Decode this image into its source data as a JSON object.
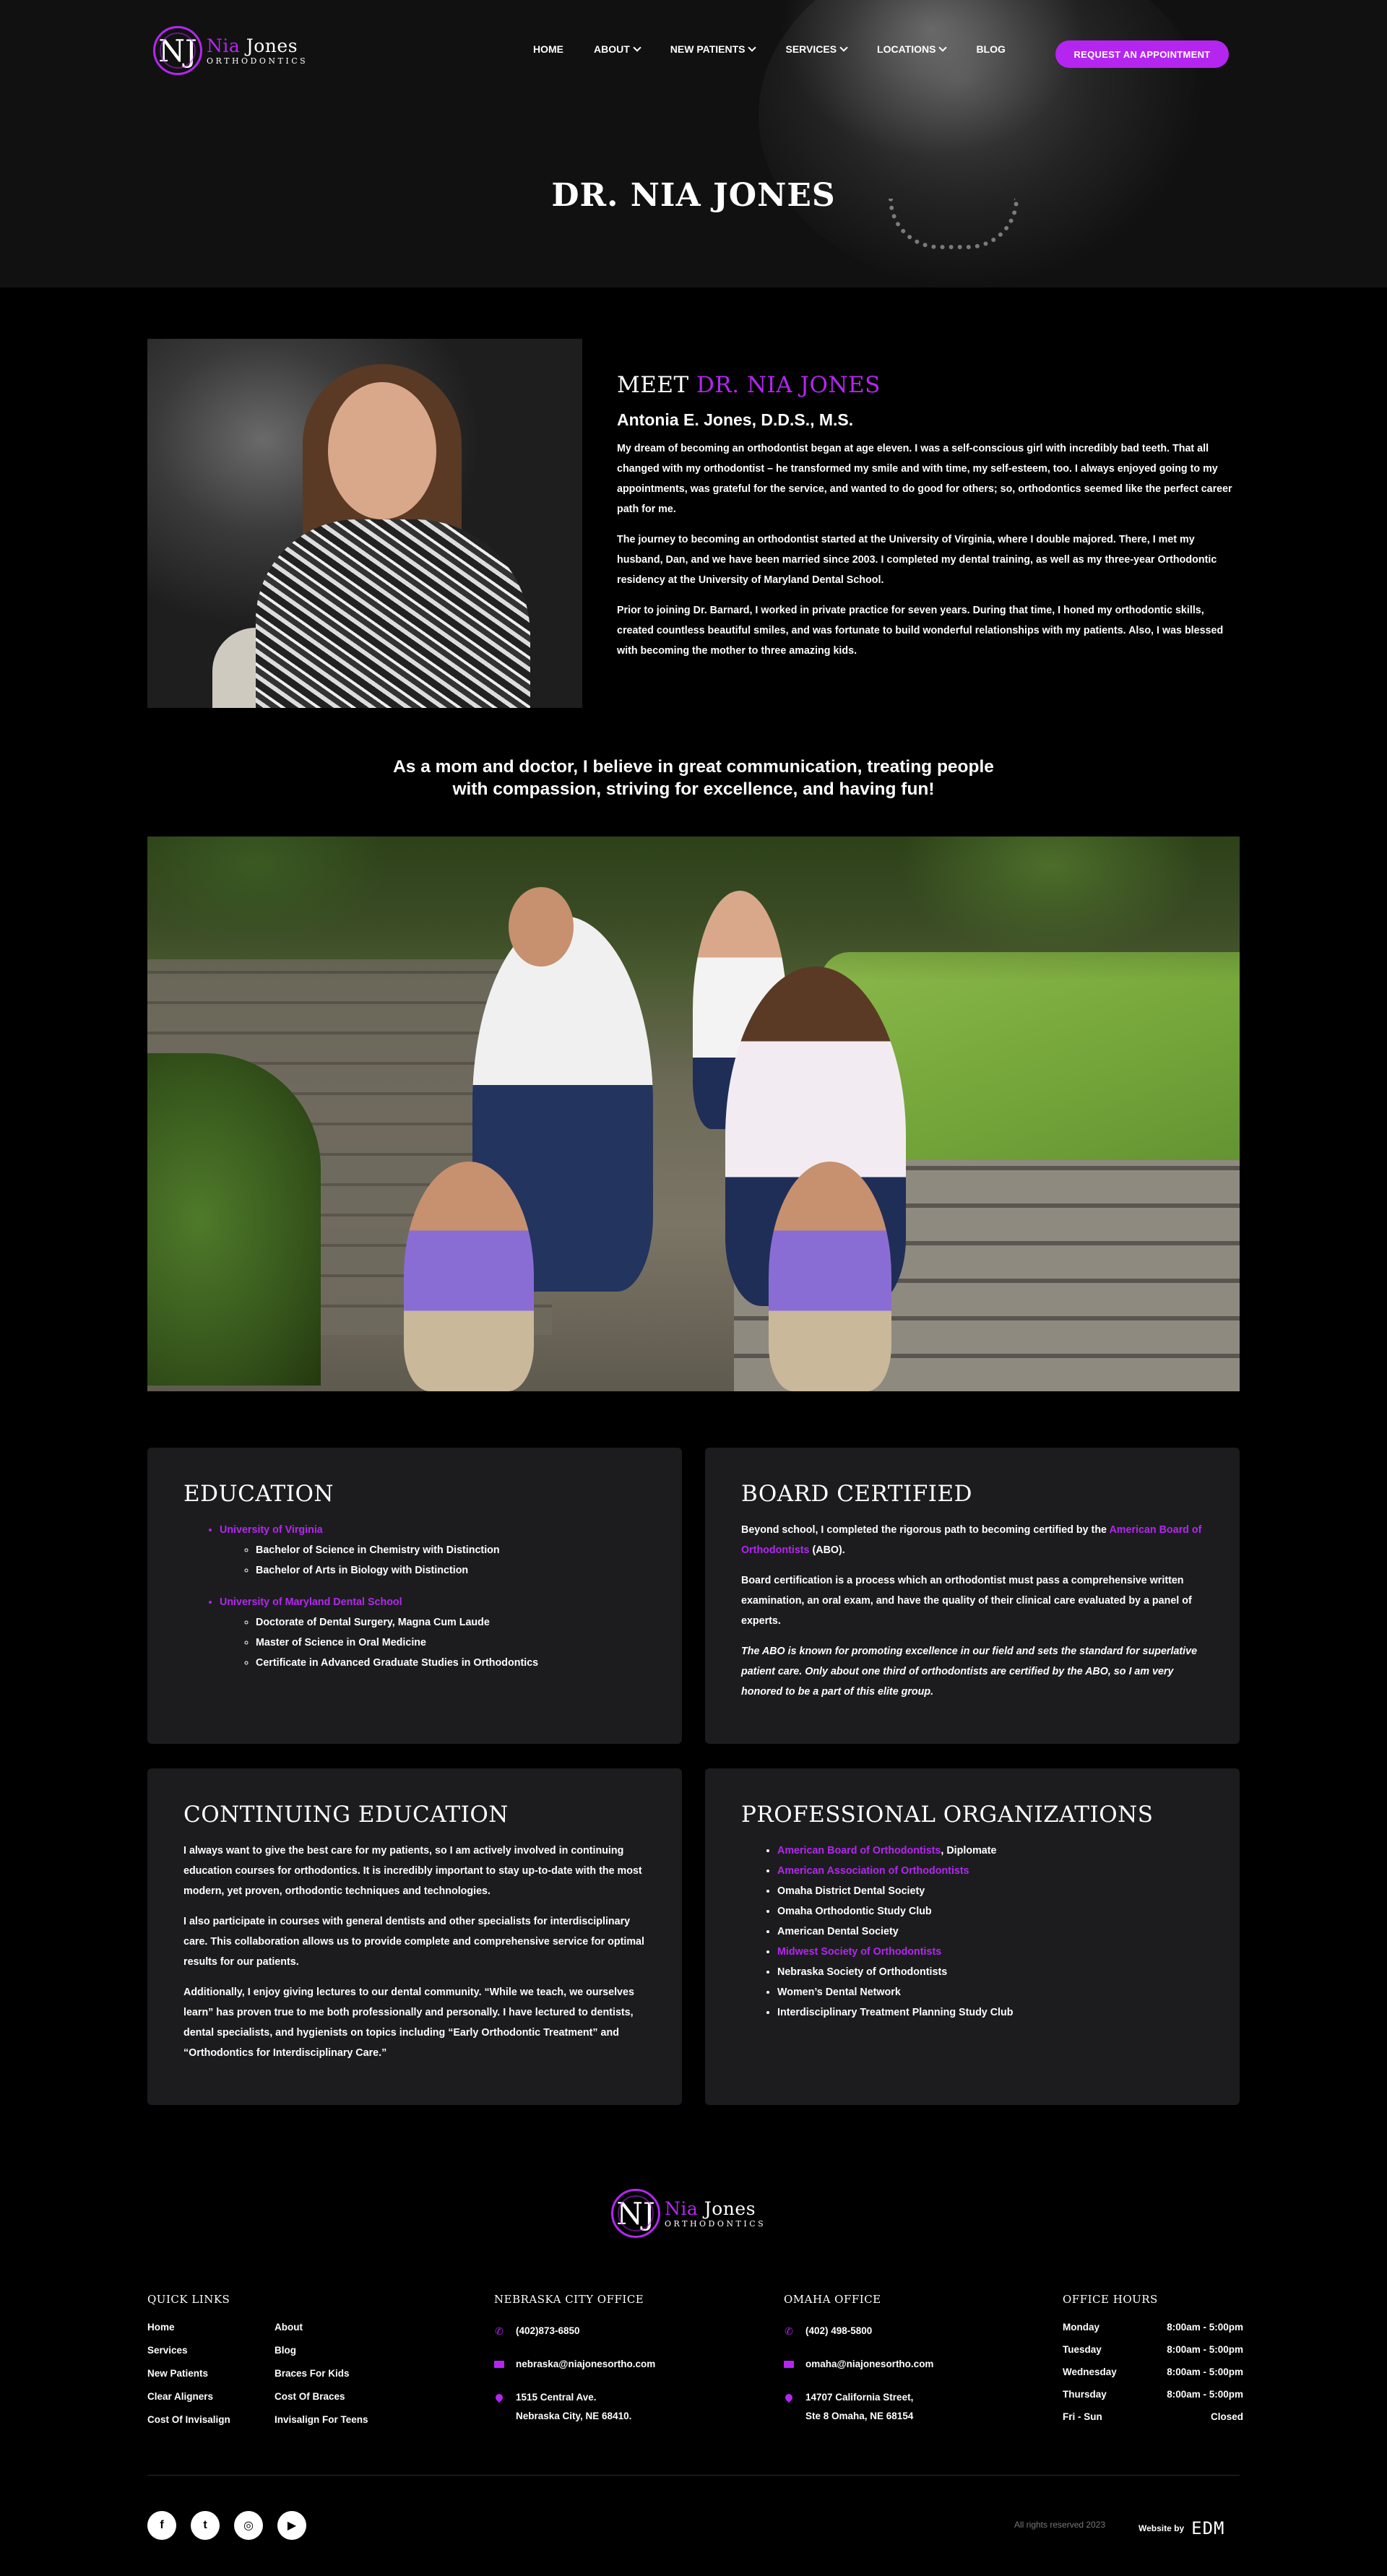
{
  "brand": {
    "mark": "NJ",
    "name_first": "Nia",
    "name_last": "Jones",
    "tagline": "ORTHODONTICS",
    "accent": "#b426f0"
  },
  "nav": {
    "items": [
      {
        "label": "HOME"
      },
      {
        "label": "ABOUT"
      },
      {
        "label": "NEW PATIENTS"
      },
      {
        "label": "SERVICES"
      },
      {
        "label": "LOCATIONS"
      },
      {
        "label": "BLOG"
      }
    ],
    "cta": "REQUEST AN APPOINTMENT"
  },
  "hero": {
    "title": "DR. NIA JONES"
  },
  "meet": {
    "heading_prefix": "MEET ",
    "heading_name": "DR. NIA JONES",
    "subtitle": "Antonia E. Jones, D.D.S., M.S.",
    "paragraphs": [
      "My dream of becoming an orthodontist began at age eleven. I was a self-conscious girl with incredibly bad teeth. That all changed with my orthodontist – he transformed my smile and with time, my self-esteem, too. I always enjoyed going to my appointments, was grateful for the service, and wanted to do good for others; so, orthodontics seemed like the perfect career path for me.",
      "The journey to becoming an orthodontist started at the University of Virginia, where I double majored. There, I met my husband, Dan, and we have been married since 2003. I completed my dental training, as well as my three-year Orthodontic residency at the University of Maryland Dental School.",
      "Prior to joining Dr. Barnard, I worked in private practice for seven years. During that time, I honed my orthodontic skills, created countless beautiful smiles, and was fortunate to build wonderful relationships with my patients. Also, I was blessed with becoming the mother to three amazing kids."
    ]
  },
  "quote": {
    "line1": "As a mom and doctor, I believe in great communication, treating people",
    "line2": "with compassion, striving for excellence, and having fun!"
  },
  "education": {
    "title": "EDUCATION",
    "schools": [
      {
        "name": "University of Virginia",
        "degrees": [
          "Bachelor of Science in Chemistry with Distinction",
          "Bachelor of Arts in Biology with Distinction"
        ]
      },
      {
        "name": "University of Maryland Dental School",
        "degrees": [
          "Doctorate of Dental Surgery, Magna Cum Laude",
          "Master of Science in Oral Medicine",
          "Certificate in Advanced Graduate Studies in Orthodontics"
        ]
      }
    ]
  },
  "board": {
    "title": "BOARD CERTIFIED",
    "p1_before": "Beyond school, I completed the rigorous path to becoming certified by the ",
    "p1_link": "American Board of Orthodontists",
    "p1_after": " (ABO).",
    "p2": "Board certification is a process which an orthodontist must pass a comprehensive written examination, an oral exam, and have the quality of their clinical care evaluated by a panel of experts.",
    "p3": "The ABO is known for promoting excellence in our field and sets the standard for superlative patient care.  Only about one third of orthodontists are certified by the ABO, so I am very honored to be a part of this elite group."
  },
  "continuing": {
    "title": "CONTINUING EDUCATION",
    "paragraphs": [
      "I always want to give the best care for my patients, so I am actively involved in continuing education courses for orthodontics.  It is incredibly important to stay up-to-date with the most modern, yet proven, orthodontic techniques and technologies.",
      "I also participate in courses with general dentists and other specialists for interdisciplinary care. This collaboration allows us to provide complete and comprehensive service for optimal results for our patients.",
      "Additionally, I enjoy giving lectures to our dental community.  “While we teach, we ourselves learn” has proven true to me both professionally and personally.  I have lectured to dentists, dental specialists, and hygienists on topics including “Early Orthodontic Treatment” and “Orthodontics for Interdisciplinary Care.”"
    ]
  },
  "organizations": {
    "title": "PROFESSIONAL ORGANIZATIONS",
    "items": [
      {
        "link": "American Board of Orthodontists",
        "text": ", Diplomate"
      },
      {
        "link": "American Association of Orthodontists",
        "text": ""
      },
      {
        "link": "",
        "text": "Omaha District Dental Society"
      },
      {
        "link": "",
        "text": "Omaha Orthodontic Study Club"
      },
      {
        "link": "",
        "text": "American Dental Society"
      },
      {
        "link": "Midwest Society of Orthodontists",
        "text": ""
      },
      {
        "link": "",
        "text": "Nebraska Society of Orthodontists"
      },
      {
        "link": "",
        "text": "Women’s Dental Network"
      },
      {
        "link": "",
        "text": "Interdisciplinary Treatment Planning Study Club"
      }
    ]
  },
  "footer": {
    "quick_links": {
      "title": "QUICK LINKS",
      "items": [
        "Home",
        "About",
        "Services",
        "Blog",
        "New Patients",
        "Braces For Kids",
        "Clear Aligners",
        "Cost Of Braces",
        "Cost Of Invisalign",
        "Invisalign For Teens"
      ]
    },
    "nebraska": {
      "title": "NEBRASKA CITY OFFICE",
      "phone": "(402)873-6850",
      "email": "nebraska@niajonesortho.com",
      "address1": "1515 Central Ave.",
      "address2": "Nebraska City, NE 68410."
    },
    "omaha": {
      "title": "OMAHA OFFICE",
      "phone": "(402) 498-5800",
      "email": "omaha@niajonesortho.com",
      "address1": "14707 California Street,",
      "address2": "Ste 8 Omaha, NE 68154"
    },
    "hours": {
      "title": "OFFICE HOURS",
      "rows": [
        {
          "day": "Monday",
          "time": "8:00am - 5:00pm"
        },
        {
          "day": "Tuesday",
          "time": "8:00am - 5:00pm"
        },
        {
          "day": "Wednesday",
          "time": "8:00am - 5:00pm"
        },
        {
          "day": "Thursday",
          "time": "8:00am - 5:00pm"
        },
        {
          "day": "Fri - Sun",
          "time": "Closed"
        }
      ]
    },
    "social": [
      {
        "icon": "facebook-icon",
        "glyph": "f"
      },
      {
        "icon": "twitter-icon",
        "glyph": "t"
      },
      {
        "icon": "instagram-icon",
        "glyph": "◎"
      },
      {
        "icon": "youtube-icon",
        "glyph": "▶"
      }
    ],
    "rights": "All rights reserved 2023",
    "website_by": "Website by",
    "agency": "EDM"
  }
}
